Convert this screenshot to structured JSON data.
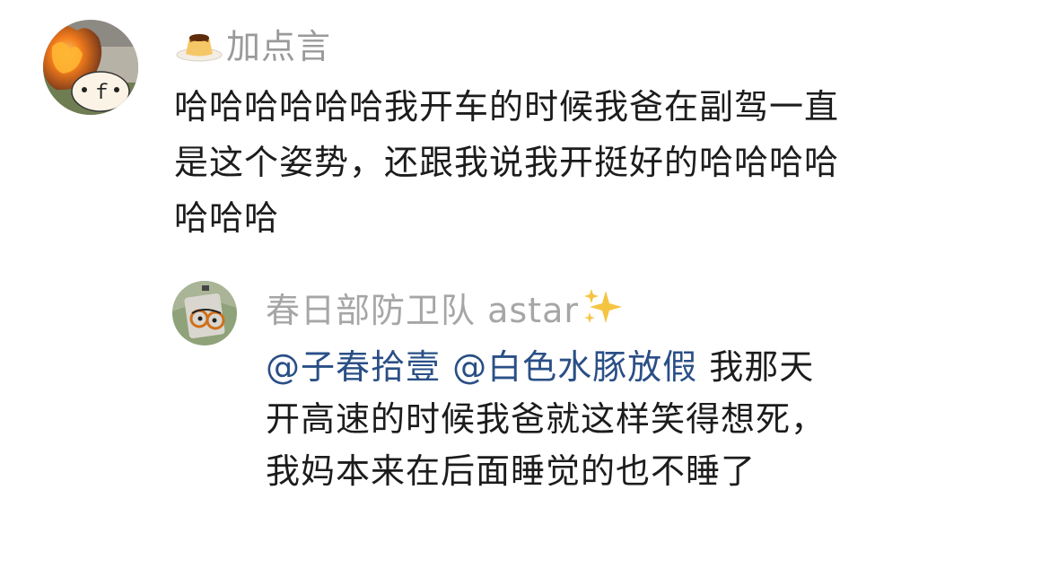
{
  "comment": {
    "username": "加点言",
    "badge_icon": "pudding-icon",
    "text_lines": [
      "哈哈哈哈哈哈我开车的时候我爸在副驾一直",
      "是这个姿势，还跟我说我开挺好的哈哈哈哈",
      "哈哈哈"
    ]
  },
  "reply": {
    "username": "春日部防卫队 astar",
    "badge_icon": "sparkles-icon",
    "mentions": [
      "@子春拾壹",
      "@白色水豚放假"
    ],
    "line1_rest": " 我那天",
    "text_lines": [
      "开高速的时候我爸就这样笑得想死，",
      "我妈本来在后面睡觉的也不睡了"
    ]
  },
  "colors": {
    "username": "#9a9a9a",
    "mention": "#2a4f86",
    "body_text": "#1c1c1c"
  }
}
